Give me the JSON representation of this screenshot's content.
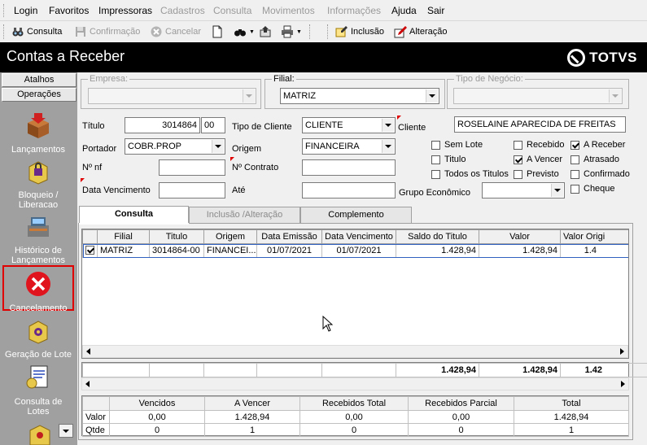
{
  "menu": [
    "Login",
    "Favoritos",
    "Impressoras",
    "Cadastros",
    "Consulta",
    "Movimentos",
    "Informações",
    "Ajuda",
    "Sair"
  ],
  "toolbar": {
    "consulta": "Consulta",
    "confirmacao": "Confirmação",
    "cancelar": "Cancelar",
    "inclusao": "Inclusão",
    "alteracao": "Alteração"
  },
  "title": "Contas a Receber",
  "brand": "TOTVS",
  "sidebar": {
    "tab_atalhos": "Atalhos",
    "tab_operacoes": "Operações",
    "items": [
      {
        "label": "Lançamentos",
        "icon": "box-arrow-icon"
      },
      {
        "label": "Bloqueio / Liberacao",
        "icon": "lock-box-icon"
      },
      {
        "label": "Histórico de Lançamentos",
        "icon": "register-icon"
      },
      {
        "label": "Cancelamento",
        "icon": "cancel-icon"
      },
      {
        "label": "Geração de Lote",
        "icon": "gear-box-icon"
      },
      {
        "label": "Consulta de Lotes",
        "icon": "document-icon"
      }
    ]
  },
  "form": {
    "empresa_label": "Empresa:",
    "empresa_value": "",
    "filial_label": "Filial:",
    "filial_value": "MATRIZ",
    "tipo_negocio_label": "Tipo de Negócio:",
    "tipo_negocio_value": "",
    "titulo_label": "Título",
    "titulo_value": "3014864",
    "titulo_parcela": "00",
    "tipo_cliente_label": "Tipo de Cliente",
    "tipo_cliente_value": "CLIENTE",
    "cliente_label": "Cliente",
    "cliente_value": "ROSELAINE APARECIDA DE FREITAS",
    "portador_label": "Portador",
    "portador_value": "COBR.PROP",
    "origem_label": "Origem",
    "origem_value": "FINANCEIRA",
    "nnf_label": "Nº nf",
    "ncontrato_label": "Nº Contrato",
    "data_venc_label": "Data Vencimento",
    "ate_label": "Até",
    "grupo_economico_label": "Grupo Econômico",
    "checks": [
      {
        "label": "Sem Lote",
        "checked": false
      },
      {
        "label": "Titulo",
        "checked": false
      },
      {
        "label": "Todos os Titulos",
        "checked": false
      },
      {
        "label": "Recebido",
        "checked": false
      },
      {
        "label": "A Vencer",
        "checked": true
      },
      {
        "label": "Previsto",
        "checked": false
      },
      {
        "label": "A Receber",
        "checked": true
      },
      {
        "label": "Atrasado",
        "checked": false
      },
      {
        "label": "Confirmado",
        "checked": false
      },
      {
        "label": "Cheque",
        "checked": false
      }
    ]
  },
  "tabs": [
    "Consulta",
    "Inclusão /Alteração",
    "Complemento"
  ],
  "grid": {
    "columns": [
      "",
      "Filial",
      "Titulo",
      "Origem",
      "Data Emissão",
      "Data Vencimento",
      "Saldo do Titulo",
      "Valor",
      "Valor Origi"
    ],
    "rows": [
      [
        "",
        "MATRIZ",
        "3014864-00",
        "FINANCEI...",
        "01/07/2021",
        "01/07/2021",
        "1.428,94",
        "1.428,94",
        "1.4"
      ]
    ],
    "totals": [
      "",
      "",
      "",
      "",
      "",
      "",
      "1.428,94",
      "1.428,94",
      "1.42"
    ]
  },
  "summary": {
    "columns": [
      "",
      "Vencidos",
      "A Vencer",
      "Recebidos Total",
      "Recebidos Parcial",
      "Total"
    ],
    "rows": [
      [
        "Valor",
        "0,00",
        "1.428,94",
        "0,00",
        "0,00",
        "1.428,94"
      ],
      [
        "Qtde",
        "0",
        "1",
        "0",
        "0",
        "1"
      ]
    ]
  }
}
